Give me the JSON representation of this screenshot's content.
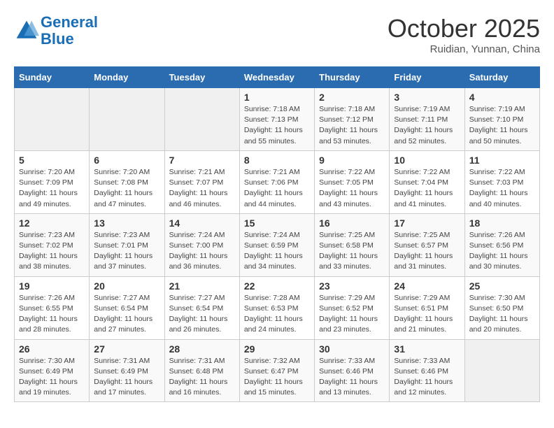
{
  "header": {
    "logo_line1": "General",
    "logo_line2": "Blue",
    "month": "October 2025",
    "location": "Ruidian, Yunnan, China"
  },
  "weekdays": [
    "Sunday",
    "Monday",
    "Tuesday",
    "Wednesday",
    "Thursday",
    "Friday",
    "Saturday"
  ],
  "weeks": [
    [
      {
        "day": "",
        "info": ""
      },
      {
        "day": "",
        "info": ""
      },
      {
        "day": "",
        "info": ""
      },
      {
        "day": "1",
        "info": "Sunrise: 7:18 AM\nSunset: 7:13 PM\nDaylight: 11 hours\nand 55 minutes."
      },
      {
        "day": "2",
        "info": "Sunrise: 7:18 AM\nSunset: 7:12 PM\nDaylight: 11 hours\nand 53 minutes."
      },
      {
        "day": "3",
        "info": "Sunrise: 7:19 AM\nSunset: 7:11 PM\nDaylight: 11 hours\nand 52 minutes."
      },
      {
        "day": "4",
        "info": "Sunrise: 7:19 AM\nSunset: 7:10 PM\nDaylight: 11 hours\nand 50 minutes."
      }
    ],
    [
      {
        "day": "5",
        "info": "Sunrise: 7:20 AM\nSunset: 7:09 PM\nDaylight: 11 hours\nand 49 minutes."
      },
      {
        "day": "6",
        "info": "Sunrise: 7:20 AM\nSunset: 7:08 PM\nDaylight: 11 hours\nand 47 minutes."
      },
      {
        "day": "7",
        "info": "Sunrise: 7:21 AM\nSunset: 7:07 PM\nDaylight: 11 hours\nand 46 minutes."
      },
      {
        "day": "8",
        "info": "Sunrise: 7:21 AM\nSunset: 7:06 PM\nDaylight: 11 hours\nand 44 minutes."
      },
      {
        "day": "9",
        "info": "Sunrise: 7:22 AM\nSunset: 7:05 PM\nDaylight: 11 hours\nand 43 minutes."
      },
      {
        "day": "10",
        "info": "Sunrise: 7:22 AM\nSunset: 7:04 PM\nDaylight: 11 hours\nand 41 minutes."
      },
      {
        "day": "11",
        "info": "Sunrise: 7:22 AM\nSunset: 7:03 PM\nDaylight: 11 hours\nand 40 minutes."
      }
    ],
    [
      {
        "day": "12",
        "info": "Sunrise: 7:23 AM\nSunset: 7:02 PM\nDaylight: 11 hours\nand 38 minutes."
      },
      {
        "day": "13",
        "info": "Sunrise: 7:23 AM\nSunset: 7:01 PM\nDaylight: 11 hours\nand 37 minutes."
      },
      {
        "day": "14",
        "info": "Sunrise: 7:24 AM\nSunset: 7:00 PM\nDaylight: 11 hours\nand 36 minutes."
      },
      {
        "day": "15",
        "info": "Sunrise: 7:24 AM\nSunset: 6:59 PM\nDaylight: 11 hours\nand 34 minutes."
      },
      {
        "day": "16",
        "info": "Sunrise: 7:25 AM\nSunset: 6:58 PM\nDaylight: 11 hours\nand 33 minutes."
      },
      {
        "day": "17",
        "info": "Sunrise: 7:25 AM\nSunset: 6:57 PM\nDaylight: 11 hours\nand 31 minutes."
      },
      {
        "day": "18",
        "info": "Sunrise: 7:26 AM\nSunset: 6:56 PM\nDaylight: 11 hours\nand 30 minutes."
      }
    ],
    [
      {
        "day": "19",
        "info": "Sunrise: 7:26 AM\nSunset: 6:55 PM\nDaylight: 11 hours\nand 28 minutes."
      },
      {
        "day": "20",
        "info": "Sunrise: 7:27 AM\nSunset: 6:54 PM\nDaylight: 11 hours\nand 27 minutes."
      },
      {
        "day": "21",
        "info": "Sunrise: 7:27 AM\nSunset: 6:54 PM\nDaylight: 11 hours\nand 26 minutes."
      },
      {
        "day": "22",
        "info": "Sunrise: 7:28 AM\nSunset: 6:53 PM\nDaylight: 11 hours\nand 24 minutes."
      },
      {
        "day": "23",
        "info": "Sunrise: 7:29 AM\nSunset: 6:52 PM\nDaylight: 11 hours\nand 23 minutes."
      },
      {
        "day": "24",
        "info": "Sunrise: 7:29 AM\nSunset: 6:51 PM\nDaylight: 11 hours\nand 21 minutes."
      },
      {
        "day": "25",
        "info": "Sunrise: 7:30 AM\nSunset: 6:50 PM\nDaylight: 11 hours\nand 20 minutes."
      }
    ],
    [
      {
        "day": "26",
        "info": "Sunrise: 7:30 AM\nSunset: 6:49 PM\nDaylight: 11 hours\nand 19 minutes."
      },
      {
        "day": "27",
        "info": "Sunrise: 7:31 AM\nSunset: 6:49 PM\nDaylight: 11 hours\nand 17 minutes."
      },
      {
        "day": "28",
        "info": "Sunrise: 7:31 AM\nSunset: 6:48 PM\nDaylight: 11 hours\nand 16 minutes."
      },
      {
        "day": "29",
        "info": "Sunrise: 7:32 AM\nSunset: 6:47 PM\nDaylight: 11 hours\nand 15 minutes."
      },
      {
        "day": "30",
        "info": "Sunrise: 7:33 AM\nSunset: 6:46 PM\nDaylight: 11 hours\nand 13 minutes."
      },
      {
        "day": "31",
        "info": "Sunrise: 7:33 AM\nSunset: 6:46 PM\nDaylight: 11 hours\nand 12 minutes."
      },
      {
        "day": "",
        "info": ""
      }
    ]
  ]
}
